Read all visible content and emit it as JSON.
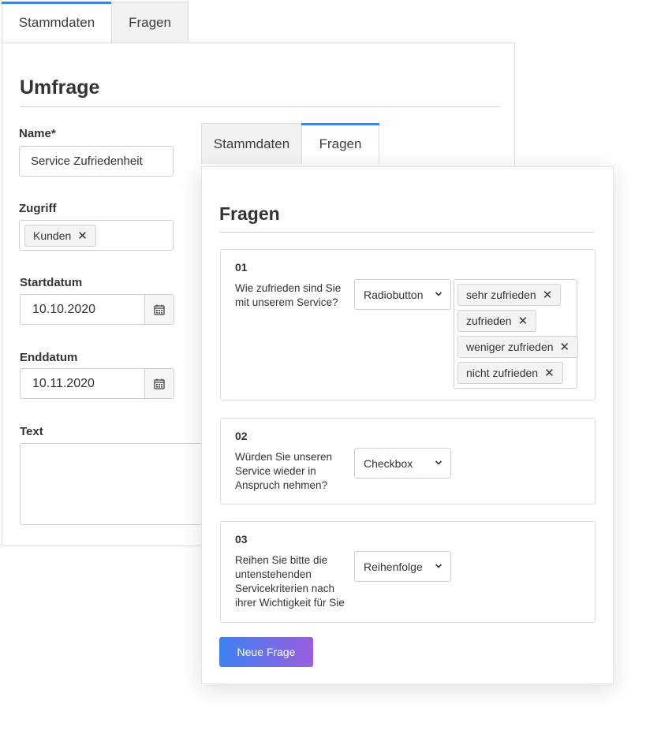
{
  "back": {
    "tabs": [
      "Stammdaten",
      "Fragen"
    ],
    "title": "Umfrage",
    "name_label": "Name*",
    "name_value": "Service Zufriedenheit",
    "access_label": "Zugriff",
    "access_tags": [
      "Kunden"
    ],
    "start_label": "Startdatum",
    "start_value": "10.10.2020",
    "end_label": "Enddatum",
    "end_value": "10.11.2020",
    "text_label": "Text"
  },
  "front": {
    "tabs": [
      "Stammdaten",
      "Fragen"
    ],
    "title": "Fragen",
    "questions": [
      {
        "number": "01",
        "text": "Wie zufrieden sind Sie mit unserem Service?",
        "type": "Radiobutton",
        "answers": [
          "sehr zufrieden",
          "zufrieden",
          "weniger zufrieden",
          "nicht zufrieden"
        ]
      },
      {
        "number": "02",
        "text": "Würden Sie unseren Service wieder in Anspruch nehmen?",
        "type": "Checkbox",
        "answers": []
      },
      {
        "number": "03",
        "text": "Reihen Sie bitte die untenstehenden Servicekriterien nach ihrer Wichtigkeit für Sie",
        "type": "Reihenfolge",
        "answers": []
      }
    ],
    "new_question_label": "Neue Frage"
  },
  "colors": {
    "tab_active_accent": "#3d82e8",
    "button_gradient_start": "#3d82f2",
    "button_gradient_end": "#9a5ee0"
  },
  "icons": {
    "date_picker": "calendar-icon",
    "tag_remove": "close-icon",
    "select_open": "chevron-down-icon"
  }
}
